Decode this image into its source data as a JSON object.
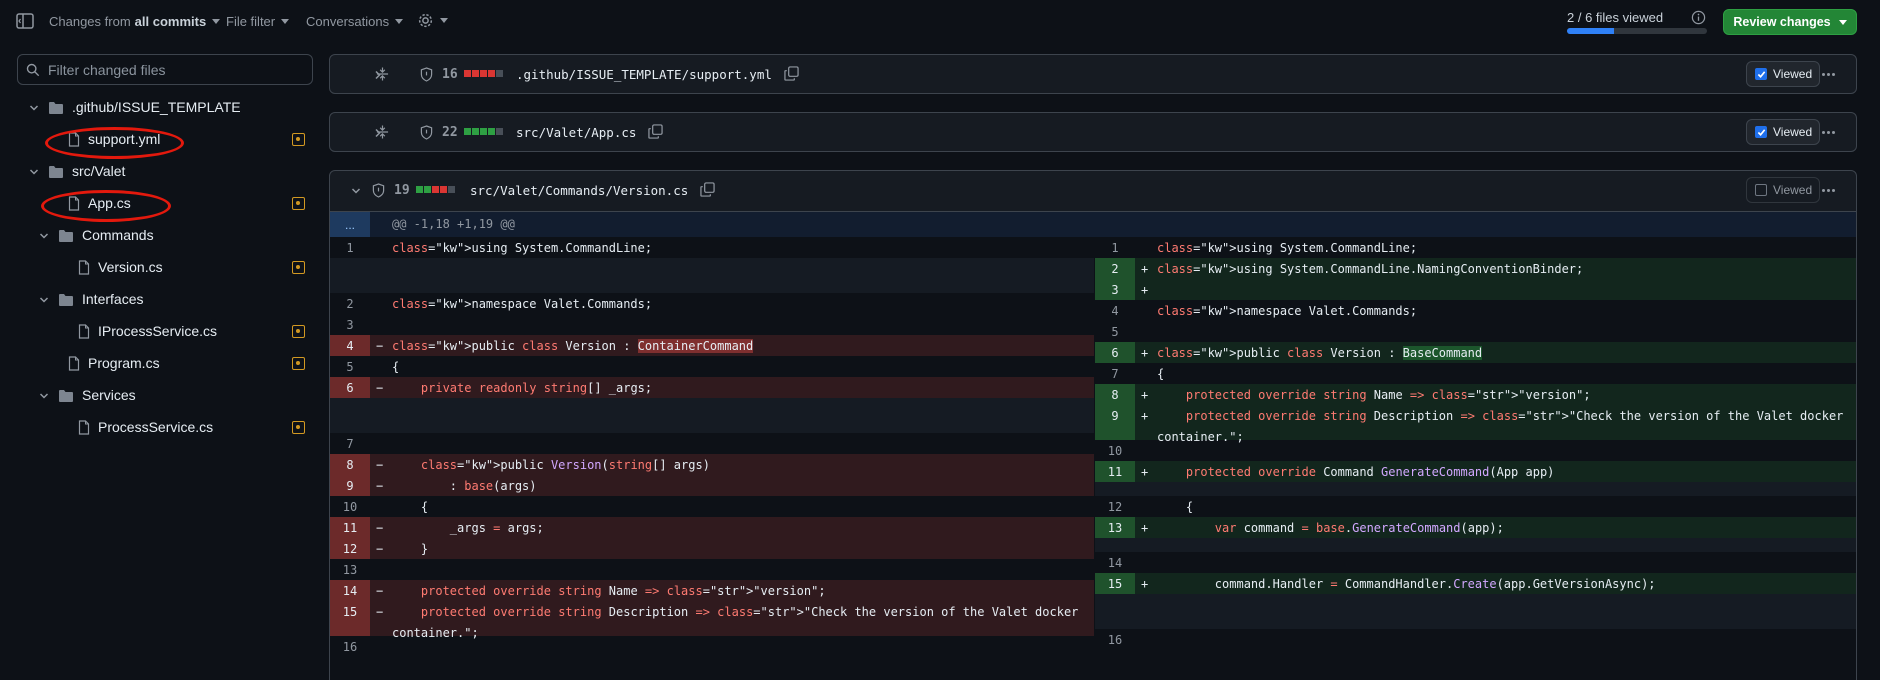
{
  "topbar": {
    "changes_prefix": "Changes from",
    "changes_bold": "all commits",
    "file_filter": "File filter",
    "conversations": "Conversations",
    "files_viewed": "2 / 6 files viewed",
    "files_viewed_fraction": 0.3333,
    "review_changes": "Review changes"
  },
  "sidebar": {
    "filter_placeholder": "Filter changed files",
    "tree": [
      {
        "label": ".github/ISSUE_TEMPLATE",
        "type": "folder"
      },
      {
        "label": "support.yml",
        "type": "file"
      },
      {
        "label": "src/Valet",
        "type": "folder"
      },
      {
        "label": "App.cs",
        "type": "file"
      },
      {
        "label": "Commands",
        "type": "folder"
      },
      {
        "label": "Version.cs",
        "type": "file"
      },
      {
        "label": "Interfaces",
        "type": "folder"
      },
      {
        "label": "IProcessService.cs",
        "type": "file"
      },
      {
        "label": "Program.cs",
        "type": "file"
      },
      {
        "label": "Services",
        "type": "folder"
      },
      {
        "label": "ProcessService.cs",
        "type": "file"
      }
    ]
  },
  "files": [
    {
      "count": "16",
      "name": ".github/ISSUE_TEMPLATE/support.yml",
      "viewed_label": "Viewed",
      "viewed": true,
      "diffstat": [
        "red",
        "red",
        "red",
        "red",
        "gray"
      ]
    },
    {
      "count": "22",
      "name": "src/Valet/App.cs",
      "viewed_label": "Viewed",
      "viewed": true,
      "diffstat": [
        "green",
        "green",
        "green",
        "green",
        "gray"
      ]
    },
    {
      "count": "19",
      "name": "src/Valet/Commands/Version.cs",
      "viewed_label": "Viewed",
      "viewed": false,
      "diffstat": [
        "green",
        "green",
        "red",
        "red",
        "gray"
      ]
    }
  ],
  "diff": {
    "hunk_expand": "...",
    "hunk_header": "@@ -1,18 +1,19 @@",
    "left": [
      {
        "num": "1",
        "type": "ctx",
        "mk": "",
        "code": "using System.CommandLine;"
      },
      {
        "num": "",
        "type": "empty",
        "mk": "",
        "code": ""
      },
      {
        "num": "2",
        "type": "ctx",
        "mk": "",
        "code": "namespace Valet.Commands;"
      },
      {
        "num": "3",
        "type": "ctx",
        "mk": "",
        "code": ""
      },
      {
        "num": "4",
        "type": "del",
        "mk": "−",
        "code": "public class Version : ContainerCommand"
      },
      {
        "num": "5",
        "type": "ctx",
        "mk": "",
        "code": "{"
      },
      {
        "num": "6",
        "type": "del",
        "mk": "−",
        "code": "    private readonly string[] _args;"
      },
      {
        "num": "",
        "type": "empty",
        "mk": "",
        "code": ""
      },
      {
        "num": "7",
        "type": "ctx",
        "mk": "",
        "code": ""
      },
      {
        "num": "8",
        "type": "del",
        "mk": "−",
        "code": "    public Version(string[] args)"
      },
      {
        "num": "9",
        "type": "del",
        "mk": "−",
        "code": "        : base(args)"
      },
      {
        "num": "10",
        "type": "ctx",
        "mk": "",
        "code": "    {"
      },
      {
        "num": "11",
        "type": "del",
        "mk": "−",
        "code": "        _args = args;"
      },
      {
        "num": "12",
        "type": "del",
        "mk": "−",
        "code": "    }"
      },
      {
        "num": "13",
        "type": "ctx",
        "mk": "",
        "code": ""
      },
      {
        "num": "14",
        "type": "del",
        "mk": "−",
        "code": "    protected override string Name => \"version\";"
      },
      {
        "num": "15",
        "type": "del",
        "mk": "−",
        "code": "    protected override string Description => \"Check the version of the Valet docker container.\";"
      },
      {
        "num": "16",
        "type": "ctx",
        "mk": "",
        "code": ""
      }
    ],
    "right": [
      {
        "num": "1",
        "type": "ctx",
        "mk": "",
        "code": "using System.CommandLine;"
      },
      {
        "num": "2",
        "type": "add",
        "mk": "+",
        "code": "using System.CommandLine.NamingConventionBinder;"
      },
      {
        "num": "3",
        "type": "add",
        "mk": "+",
        "code": ""
      },
      {
        "num": "4",
        "type": "ctx",
        "mk": "",
        "code": "namespace Valet.Commands;"
      },
      {
        "num": "5",
        "type": "ctx",
        "mk": "",
        "code": ""
      },
      {
        "num": "6",
        "type": "add",
        "mk": "+",
        "code": "public class Version : BaseCommand"
      },
      {
        "num": "7",
        "type": "ctx",
        "mk": "",
        "code": "{"
      },
      {
        "num": "8",
        "type": "add",
        "mk": "+",
        "code": "    protected override string Name => \"version\";"
      },
      {
        "num": "9",
        "type": "add",
        "mk": "+",
        "code": "    protected override string Description => \"Check the version of the Valet docker container.\";"
      },
      {
        "num": "10",
        "type": "ctx",
        "mk": "",
        "code": ""
      },
      {
        "num": "11",
        "type": "add",
        "mk": "+",
        "code": "    protected override Command GenerateCommand(App app)"
      },
      {
        "num": "",
        "type": "empty",
        "mk": "",
        "code": ""
      },
      {
        "num": "12",
        "type": "ctx",
        "mk": "",
        "code": "    {"
      },
      {
        "num": "13",
        "type": "add",
        "mk": "+",
        "code": "        var command = base.GenerateCommand(app);"
      },
      {
        "num": "",
        "type": "empty",
        "mk": "",
        "code": ""
      },
      {
        "num": "14",
        "type": "ctx",
        "mk": "",
        "code": ""
      },
      {
        "num": "15",
        "type": "add",
        "mk": "+",
        "code": "        command.Handler = CommandHandler.Create(app.GetVersionAsync);"
      },
      {
        "num": "",
        "type": "empty",
        "mk": "",
        "code": ""
      },
      {
        "num": "16",
        "type": "ctx",
        "mk": "",
        "code": ""
      }
    ]
  }
}
